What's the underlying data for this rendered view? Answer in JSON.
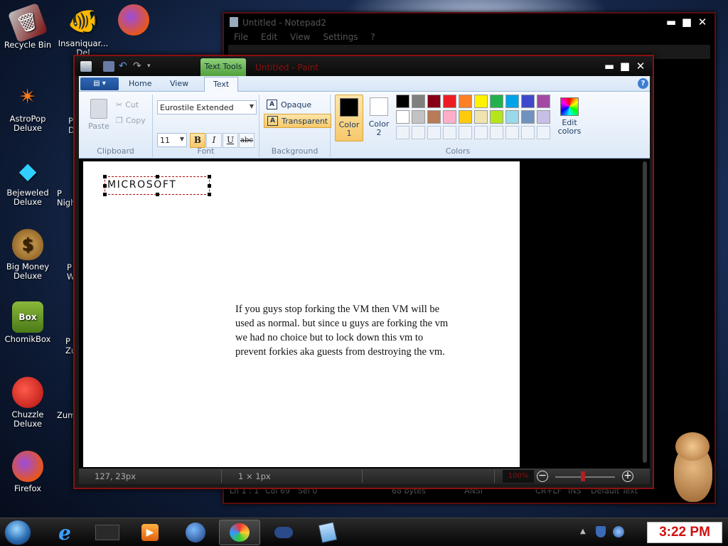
{
  "desktop": {
    "icons": [
      {
        "label": "Recycle Bin",
        "icon": "recycle-bin-icon"
      },
      {
        "label": "Insaniquar...\nDel",
        "icon": "fish-icon"
      },
      {
        "label": "AstroPop\nDeluxe",
        "icon": "astropop-icon"
      },
      {
        "label": "Bejeweled\nDeluxe",
        "icon": "gem-icon"
      },
      {
        "label": "Big Money\nDeluxe",
        "icon": "money-bag-icon"
      },
      {
        "label": "ChomikBox",
        "icon": "hamster-box-icon"
      },
      {
        "label": "Chuzzle\nDeluxe",
        "icon": "chuzzle-icon"
      },
      {
        "label": "Firefox",
        "icon": "firefox-icon"
      }
    ],
    "partial_labels": [
      "P\nD",
      "P\nNigh",
      "P\nW",
      "P\nZu",
      "Zum"
    ]
  },
  "notepad": {
    "title": "Untitled - Notepad2",
    "menu": [
      "File",
      "Edit",
      "View",
      "Settings",
      "?"
    ],
    "status": {
      "position": "Ln 1 : 1",
      "col": "Col 69",
      "sel": "Sel 0",
      "size": "68 bytes",
      "encoding": "ANSI",
      "eol": "CR+LF",
      "ins": "INS",
      "scheme": "Default Text"
    }
  },
  "paint": {
    "title": "Untitled - Paint",
    "contextual_tab": "Text Tools",
    "tabs": [
      "Home",
      "View",
      "Text"
    ],
    "active_tab": "Text",
    "clipboard": {
      "paste": "Paste",
      "cut": "Cut",
      "copy": "Copy",
      "label": "Clipboard"
    },
    "font": {
      "family": "Eurostile Extended",
      "size": "11",
      "bold": "B",
      "italic": "I",
      "underline": "U",
      "strike": "abc",
      "label": "Font"
    },
    "background": {
      "opaque": "Opaque",
      "transparent": "Transparent",
      "label": "Background"
    },
    "colors": {
      "color1_label": "Color\n1",
      "color2_label": "Color\n2",
      "color1": "#000000",
      "color2": "#ffffff",
      "edit_label": "Edit\ncolors",
      "label": "Colors",
      "palette_row1": [
        "#000000",
        "#7f7f7f",
        "#880015",
        "#ed1c24",
        "#ff7f27",
        "#fff200",
        "#22b14c",
        "#00a2e8",
        "#3f48cc",
        "#a349a4"
      ],
      "palette_row2": [
        "#ffffff",
        "#c3c3c3",
        "#b97a57",
        "#ffaec9",
        "#ffc90e",
        "#efe4b0",
        "#b5e61d",
        "#99d9ea",
        "#7092be",
        "#c8bfe7"
      ]
    },
    "canvas": {
      "selected_text": "MICROSOFT",
      "message": "If you guys stop forking the VM then VM will be used as normal. but since u guys are forking the vm we had no choice but to lock down this vm to prevent forkies aka guests from destroying the vm."
    },
    "status": {
      "cursor": "127, 23px",
      "selection": "1 × 1px",
      "zoom": "100%"
    }
  },
  "taskbar": {
    "clock": "3:22 PM",
    "items": [
      "internet-explorer-icon",
      "media-player-icon",
      "globe-icon",
      "paint-icon",
      "network-icon",
      "notepad-icon"
    ]
  }
}
